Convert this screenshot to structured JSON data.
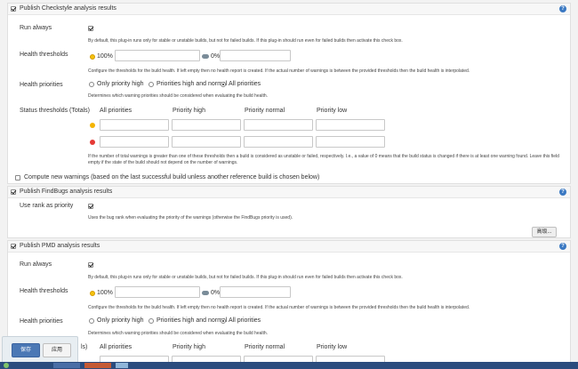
{
  "checkstyle": {
    "title": "Publish Checkstyle analysis results",
    "run_always_label": "Run always",
    "run_always_desc": "By default, this plug-in runs only for stable or unstable builds, but not for failed builds. If this plug-in should run even for failed builds then activate this check box.",
    "health_label": "Health thresholds",
    "health_100": "100%",
    "health_0": "0%",
    "health_desc": "Configure the thresholds for the build health. If left empty then no health report is created. If the actual number of warnings is between the provided thresholds then the build health is interpolated.",
    "priorities_label": "Health priorities",
    "priority_options": [
      "Only priority high",
      "Priorities high and normal",
      "All priorities"
    ],
    "priorities_desc": "Determines which warning priorities should be considered when evaluating the build health.",
    "status_label": "Status thresholds (Totals)",
    "status_cols": [
      "All priorities",
      "Priority high",
      "Priority normal",
      "Priority low"
    ],
    "status_desc": "If the number of total warnings is greater than one of these thresholds then a build is considered as unstable or failed, respectively. I.e., a value of 0 means that the build status is changed if there is at least one warning found. Leave this field empty if the state of the build should not depend on the number of warnings.",
    "compute_new": "Compute new warnings (based on the last successful build unless another reference build is chosen below)"
  },
  "findbugs": {
    "title": "Publish FindBugs analysis results",
    "use_rank_label": "Use rank as priority",
    "use_rank_desc": "Uses the bug rank when evaluating the priority of the warnings (otherwise the FindBugs priority is used).",
    "advanced_btn": "高级..."
  },
  "pmd": {
    "title": "Publish PMD analysis results",
    "run_always_label": "Run always",
    "run_always_desc": "By default, this plug-in runs only for stable or unstable builds, but not for failed builds. If this plug-in should run even for failed builds then activate this check box.",
    "health_label": "Health thresholds",
    "health_100": "100%",
    "health_0": "0%",
    "health_desc": "Configure the thresholds for the build health. If left empty then no health report is created. If the actual number of warnings is between the provided thresholds then the build health is interpolated.",
    "priorities_label": "Health priorities",
    "priority_options": [
      "Only priority high",
      "Priorities high and normal",
      "All priorities"
    ],
    "priorities_desc": "Determines which warning priorities should be considered when evaluating the build health.",
    "status_label_tail": "ls)",
    "status_cols": [
      "All priorities",
      "Priority high",
      "Priority normal",
      "Priority low"
    ]
  },
  "footer": {
    "save": "保存",
    "apply": "应用"
  },
  "colors": {
    "help": "#3a78c2",
    "save_bg": "#4b78b5",
    "taskbar": "#2b4c7e"
  }
}
